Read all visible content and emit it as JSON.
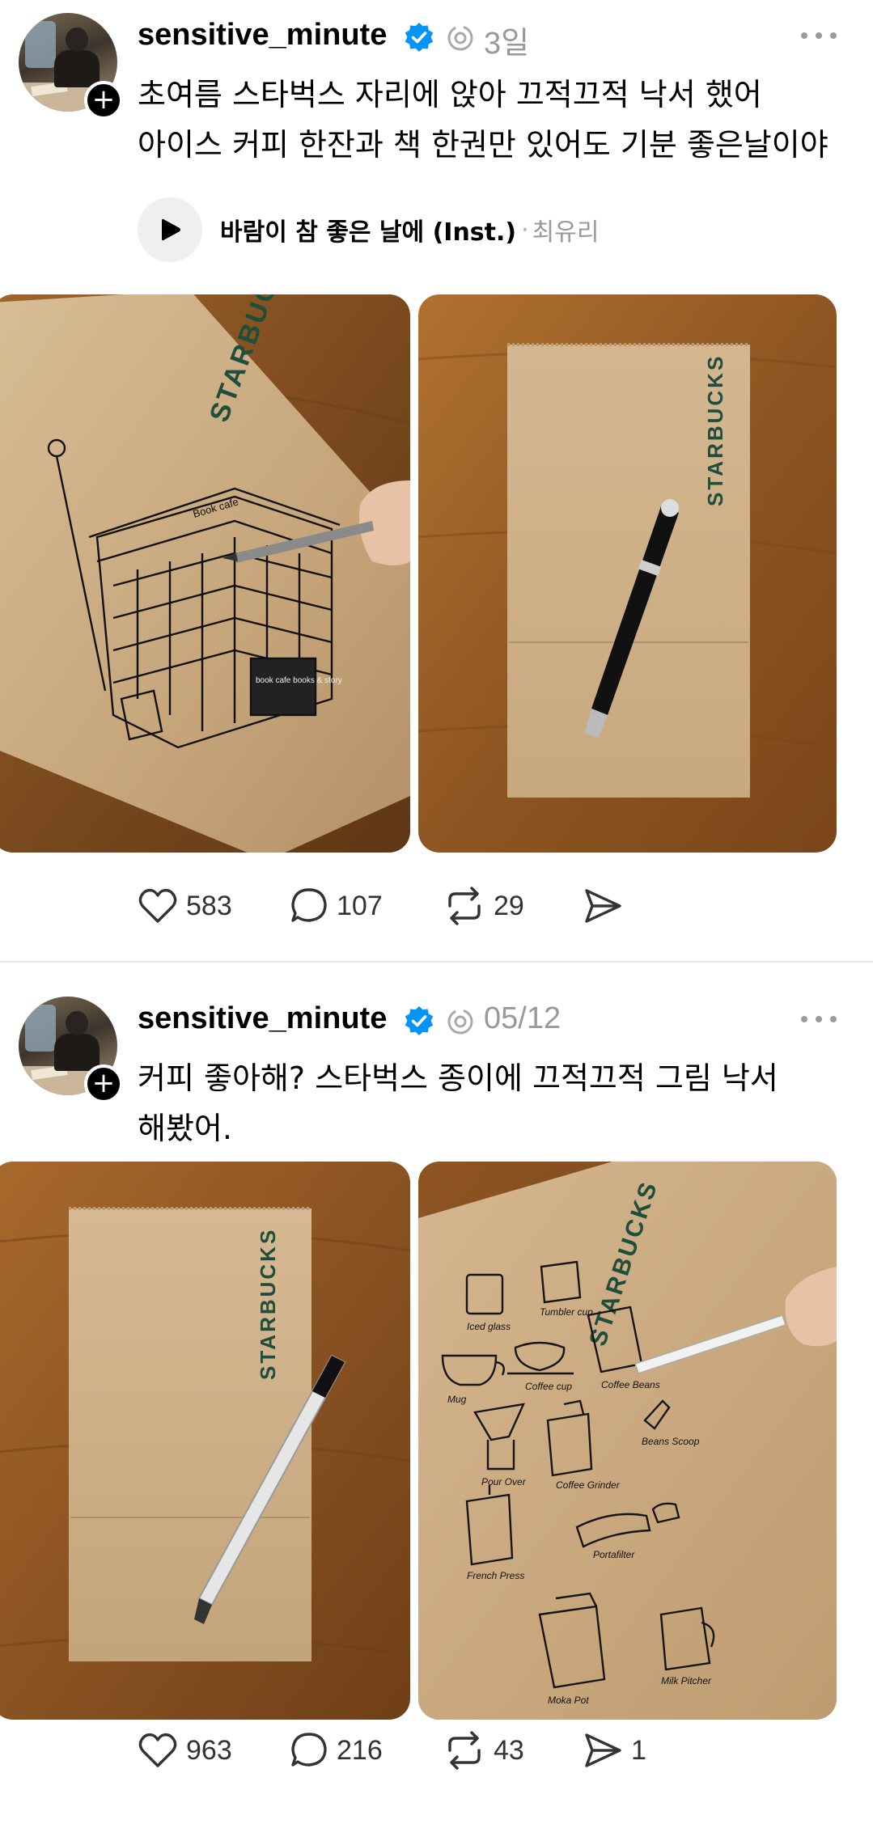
{
  "posts": [
    {
      "username": "sensitive_minute",
      "timestamp": "3일",
      "caption_line1": "초여름 스타벅스 자리에 앉아 끄적끄적 낙서 했어",
      "caption_line2": "아이스 커피 한잔과 책 한권만 있어도 기분 좋은날이야",
      "music": {
        "title": "바람이 참 좋은 날에 (Inst.)",
        "separator": "·",
        "artist": "최유리"
      },
      "photos": [
        {
          "subject": "starbucks bag with bookstore drawing",
          "logo_text": "STARBUCKS",
          "sign_text": "Book cafe",
          "board_text": "book cafe books & story"
        },
        {
          "subject": "blank starbucks bag with black pen",
          "logo_text": "STARBUCKS"
        }
      ],
      "stats": {
        "likes": "583",
        "comments": "107",
        "reposts": "29",
        "shares": ""
      }
    },
    {
      "username": "sensitive_minute",
      "timestamp": "05/12",
      "caption_line1": "커피 좋아해? 스타벅스 종이에 끄적끄적 그림 낙서",
      "caption_line2": "해봤어.",
      "photos": [
        {
          "subject": "blank starbucks bag with clear pen",
          "logo_text": "STARBUCKS"
        },
        {
          "subject": "starbucks bag with coffee tools drawing",
          "logo_text": "STARBUCKS",
          "item_labels": [
            "Iced glass",
            "Tumbler cup",
            "Mug",
            "Coffee cup",
            "Coffee Beans",
            "Pour Over",
            "Coffee Grinder",
            "Beans Scoop",
            "French Press",
            "Portafilter",
            "Moka Pot",
            "Milk Pitcher"
          ]
        }
      ],
      "stats": {
        "likes": "963",
        "comments": "216",
        "reposts": "43",
        "shares": "1"
      }
    }
  ],
  "colors": {
    "verified_blue": "#0095f6",
    "muted_gray": "#999999",
    "kraft_paper": "#c9a77c",
    "wood_table": "#8a5524"
  },
  "icons": [
    "plus-icon",
    "verified-badge-icon",
    "repost-small-icon",
    "more-dots-icon",
    "play-icon",
    "heart-icon",
    "comment-icon",
    "repost-icon",
    "share-icon"
  ]
}
